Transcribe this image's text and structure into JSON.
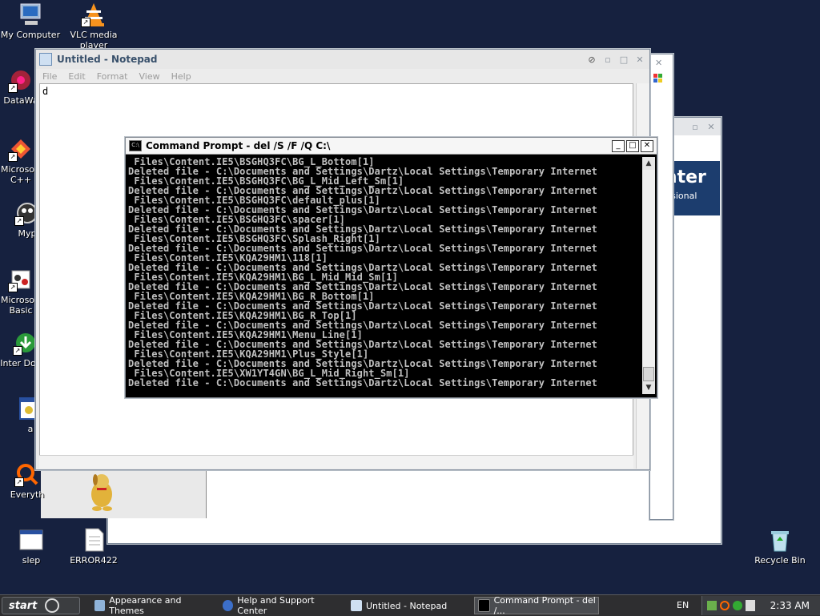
{
  "desktop": {
    "icons": [
      {
        "label": "My Computer",
        "icon": "computer-icon"
      },
      {
        "label": "VLC media player",
        "icon": "vlc-icon"
      },
      {
        "label": "DataWa",
        "icon": "datawave-icon"
      },
      {
        "label": "Microsoft C++",
        "icon": "visual-cpp-icon"
      },
      {
        "label": "Myp",
        "icon": "mypal-icon"
      },
      {
        "label": "Microsoft Basic",
        "icon": "visual-basic-icon"
      },
      {
        "label": "Inter Downl",
        "icon": "internet-download-icon"
      },
      {
        "label": "a",
        "icon": "app-icon"
      },
      {
        "label": "Everyth",
        "icon": "everything-search-icon"
      },
      {
        "label": "slep",
        "icon": "batch-file-icon"
      },
      {
        "label": "ERROR422",
        "icon": "text-file-icon"
      },
      {
        "label": "Recycle Bin",
        "icon": "recycle-bin-icon"
      }
    ]
  },
  "notepad": {
    "title": "Untitled - Notepad",
    "menu": [
      "File",
      "Edit",
      "Format",
      "View",
      "Help"
    ],
    "content": "d"
  },
  "cmd": {
    "title": "Command Prompt - del /S /F /Q C:\\",
    "lines": [
      " Files\\Content.IE5\\BSGHQ3FC\\BG_L_Bottom[1]",
      "Deleted file - C:\\Documents and Settings\\Dartz\\Local Settings\\Temporary Internet",
      " Files\\Content.IE5\\BSGHQ3FC\\BG_L_Mid_Left_Sm[1]",
      "Deleted file - C:\\Documents and Settings\\Dartz\\Local Settings\\Temporary Internet",
      " Files\\Content.IE5\\BSGHQ3FC\\default_plus[1]",
      "Deleted file - C:\\Documents and Settings\\Dartz\\Local Settings\\Temporary Internet",
      " Files\\Content.IE5\\BSGHQ3FC\\spacer[1]",
      "Deleted file - C:\\Documents and Settings\\Dartz\\Local Settings\\Temporary Internet",
      " Files\\Content.IE5\\BSGHQ3FC\\Splash_Right[1]",
      "Deleted file - C:\\Documents and Settings\\Dartz\\Local Settings\\Temporary Internet",
      " Files\\Content.IE5\\KQA29HM1\\118[1]",
      "Deleted file - C:\\Documents and Settings\\Dartz\\Local Settings\\Temporary Internet",
      " Files\\Content.IE5\\KQA29HM1\\BG_L_Mid_Mid_Sm[1]",
      "Deleted file - C:\\Documents and Settings\\Dartz\\Local Settings\\Temporary Internet",
      " Files\\Content.IE5\\KQA29HM1\\BG_R_Bottom[1]",
      "Deleted file - C:\\Documents and Settings\\Dartz\\Local Settings\\Temporary Internet",
      " Files\\Content.IE5\\KQA29HM1\\BG_R_Top[1]",
      "Deleted file - C:\\Documents and Settings\\Dartz\\Local Settings\\Temporary Internet",
      " Files\\Content.IE5\\KQA29HM1\\Menu_Line[1]",
      "Deleted file - C:\\Documents and Settings\\Dartz\\Local Settings\\Temporary Internet",
      " Files\\Content.IE5\\KQA29HM1\\Plus_Style[1]",
      "Deleted file - C:\\Documents and Settings\\Dartz\\Local Settings\\Temporary Internet",
      " Files\\Content.IE5\\XW1YT4GN\\BG_L_Mid_Right_Sm[1]",
      "Deleted file - C:\\Documents and Settings\\Dartz\\Local Settings\\Temporary Internet"
    ]
  },
  "help_window": {
    "banner_text": "enter",
    "banner_sub": "ofessional"
  },
  "taskbar": {
    "start_label": "start",
    "tasks": [
      {
        "label": "Appearance and Themes",
        "icon": "appearance-icon"
      },
      {
        "label": "Help and Support Center",
        "icon": "help-icon"
      },
      {
        "label": "Untitled - Notepad",
        "icon": "notepad-icon"
      },
      {
        "label": "Command Prompt - del /...",
        "icon": "cmd-icon"
      }
    ],
    "language": "EN",
    "clock": "2:33 AM"
  }
}
